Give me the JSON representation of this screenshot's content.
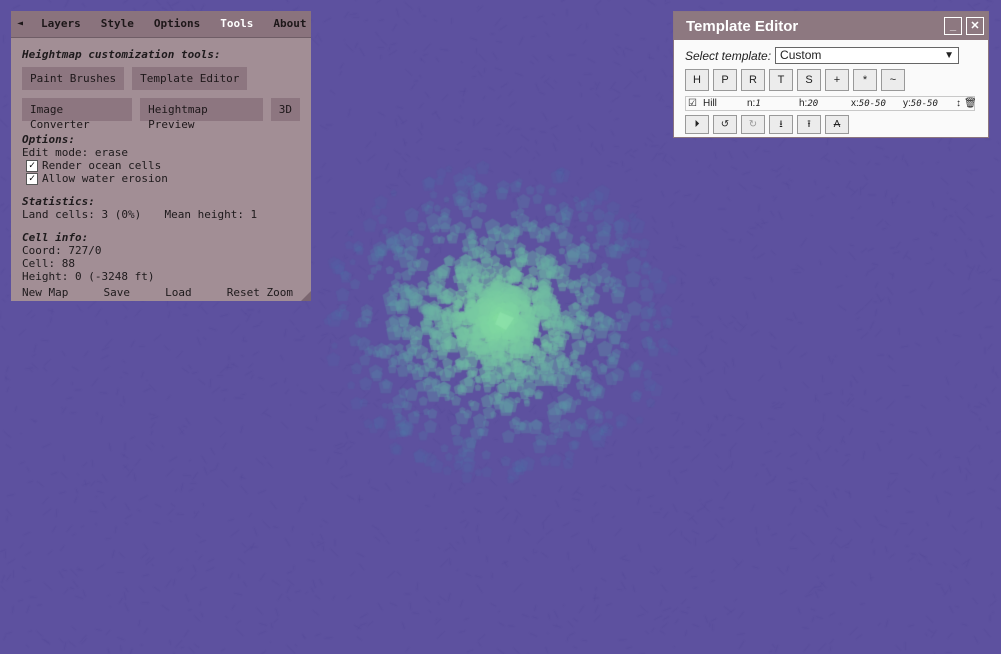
{
  "colors": {
    "ocean": "#5d519f",
    "panel": "#a28e95",
    "panel_tabbar": "#8a737d",
    "tool_button": "#8d7680",
    "editor_titlebar": "#8d7880",
    "land_low": "#4a8ab5",
    "land_high": "#8fe0a8"
  },
  "options_panel": {
    "tabs": {
      "collapse": "◄",
      "layers": "Layers",
      "style": "Style",
      "options": "Options",
      "tools": "Tools",
      "about": "About"
    },
    "tools_heading": "Heightmap customization tools:",
    "buttons": {
      "paint_brushes": "Paint Brushes",
      "template_editor": "Template Editor",
      "image_converter": "Image Converter",
      "heightmap_preview": "Heightmap Preview",
      "three_d": "3D"
    },
    "options_heading": "Options:",
    "edit_mode": "Edit mode: erase",
    "render_ocean": "Render ocean cells",
    "allow_erosion": "Allow water erosion",
    "check_mark": "✓",
    "statistics_heading": "Statistics:",
    "land_cells": "Land cells: 3 (0%)",
    "mean_height": "Mean height: 1",
    "cell_info_heading": "Cell info:",
    "coord": "Coord: 727/0",
    "cell": "Cell: 88",
    "height": "Height: 0 (-3248 ft)",
    "bottom": {
      "new_map": "New Map",
      "save": "Save",
      "load": "Load",
      "reset_zoom": "Reset Zoom"
    }
  },
  "template_editor": {
    "title": "Template Editor",
    "minimize": "_",
    "close": "✕",
    "select_label": "Select template:",
    "select_value": "Custom",
    "select_arrow": "▼",
    "step_buttons": [
      "H",
      "P",
      "R",
      "T",
      "S",
      "+",
      "*",
      "~"
    ],
    "step": {
      "check": "☑",
      "name": "Hill",
      "n_label": "n:",
      "n_value": "1",
      "h_label": "h:",
      "h_value": "20",
      "x_label": "x:",
      "x_value": "50-50",
      "y_label": "y:",
      "y_value": "50-50",
      "move_icon": "↕",
      "delete_icon": "🗑"
    },
    "actions": {
      "play": "⏵",
      "undo": "↺",
      "redo": "↻",
      "download": "⭳",
      "upload": "⭱",
      "font": "A"
    }
  }
}
